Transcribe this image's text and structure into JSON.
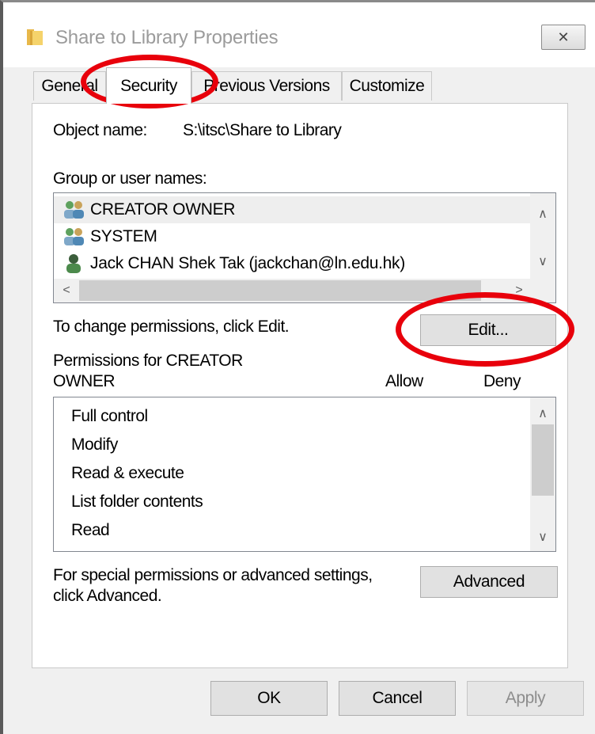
{
  "window": {
    "title": "Share to Library Properties",
    "close_glyph": "✕"
  },
  "tabs": [
    {
      "label": "General",
      "active": false
    },
    {
      "label": "Security",
      "active": true
    },
    {
      "label": "Previous Versions",
      "active": false
    },
    {
      "label": "Customize",
      "active": false
    }
  ],
  "security": {
    "object_name_label": "Object name:",
    "object_name_value": "S:\\itsc\\Share to Library",
    "group_label": "Group or user names:",
    "users": [
      {
        "name": "CREATOR OWNER",
        "icon": "group-icon",
        "selected": true
      },
      {
        "name": "SYSTEM",
        "icon": "group-icon",
        "selected": false
      },
      {
        "name": "Jack CHAN Shek Tak (jackchan@ln.edu.hk)",
        "icon": "user-icon",
        "selected": false
      }
    ],
    "change_hint": "To change permissions, click Edit.",
    "edit_button": "Edit...",
    "permissions_label_line1": "Permissions for CREATOR",
    "permissions_label_line2": "OWNER",
    "allow_header": "Allow",
    "deny_header": "Deny",
    "permissions": [
      "Full control",
      "Modify",
      "Read & execute",
      "List folder contents",
      "Read"
    ],
    "advanced_hint_line1": "For special permissions or advanced settings,",
    "advanced_hint_line2": "click Advanced.",
    "advanced_button": "Advanced"
  },
  "footer": {
    "ok": "OK",
    "cancel": "Cancel",
    "apply": "Apply"
  },
  "scroll_glyphs": {
    "up": "∧",
    "down": "∨",
    "left": "<",
    "right": ">"
  },
  "colors": {
    "highlight": "#e8000b",
    "selected_row": "#eeeeee",
    "title_text": "#9b9b9b"
  }
}
